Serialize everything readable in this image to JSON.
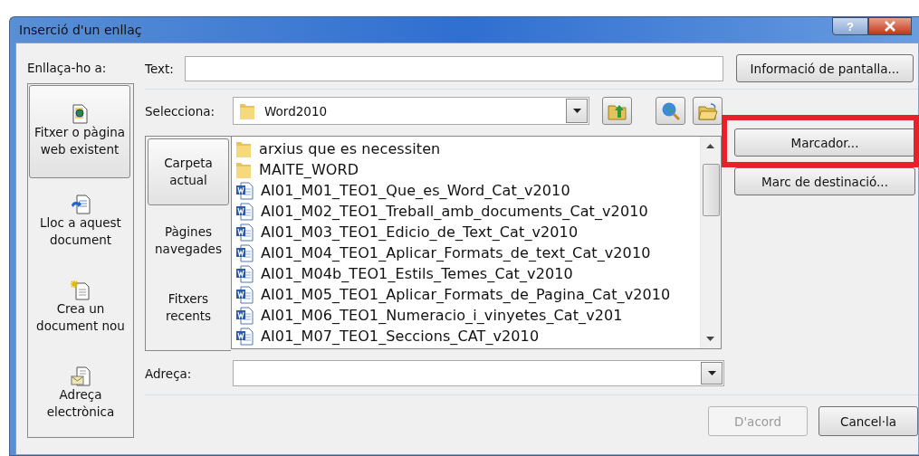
{
  "window": {
    "title": "Inserció d'un enllaç",
    "help_button": "?"
  },
  "link_to": {
    "label": "Enllaça-ho a:",
    "items": [
      {
        "label": "Fitxer o pàgina web existent",
        "kind": "file",
        "selected": true
      },
      {
        "label": "Lloc a aquest document",
        "kind": "place",
        "selected": false
      },
      {
        "label": "Crea un document nou",
        "kind": "new",
        "selected": false
      },
      {
        "label": "Adreça electrònica",
        "kind": "mail",
        "selected": false
      }
    ]
  },
  "text_field": {
    "label": "Text:"
  },
  "screen_tip_button": "Informació de pantalla...",
  "look_in": {
    "label": "Selecciona:",
    "value": "Word2010"
  },
  "views": [
    {
      "label": "Carpeta actual",
      "selected": true
    },
    {
      "label": "Pàgines navegades",
      "selected": false
    },
    {
      "label": "Fitxers recents",
      "selected": false
    }
  ],
  "files": [
    {
      "name": "arxius que es necessiten",
      "kind": "folder"
    },
    {
      "name": "MAITE_WORD",
      "kind": "folder"
    },
    {
      "name": "AI01_M01_TEO1_Que_es_Word_Cat_v2010",
      "kind": "doc"
    },
    {
      "name": "AI01_M02_TEO1_Treball_amb_documents_Cat_v2010",
      "kind": "doc"
    },
    {
      "name": "AI01_M03_TEO1_Edicio_de_Text_Cat_v2010",
      "kind": "doc"
    },
    {
      "name": "AI01_M04_TEO1_Aplicar_Formats_de_text_Cat_v2010",
      "kind": "doc"
    },
    {
      "name": "AI01_M04b_TEO1_Estils_Temes_Cat_v2010",
      "kind": "doc"
    },
    {
      "name": "AI01_M05_TEO1_Aplicar_Formats_de_Pagina_Cat_v2010",
      "kind": "doc"
    },
    {
      "name": "AI01_M06_TEO1_Numeracio_i_vinyetes_Cat_v201",
      "kind": "doc"
    },
    {
      "name": "AI01_M07_TEO1_Seccions_CAT_v2010",
      "kind": "doc"
    }
  ],
  "side_buttons": [
    {
      "label": "Marcador...",
      "highlighted": true
    },
    {
      "label": "Marc de destinació...",
      "highlighted": false
    }
  ],
  "address": {
    "label": "Adreça:"
  },
  "buttons": [
    {
      "label": "D'acord",
      "disabled": true
    },
    {
      "label": "Cancel·la",
      "disabled": false
    }
  ]
}
